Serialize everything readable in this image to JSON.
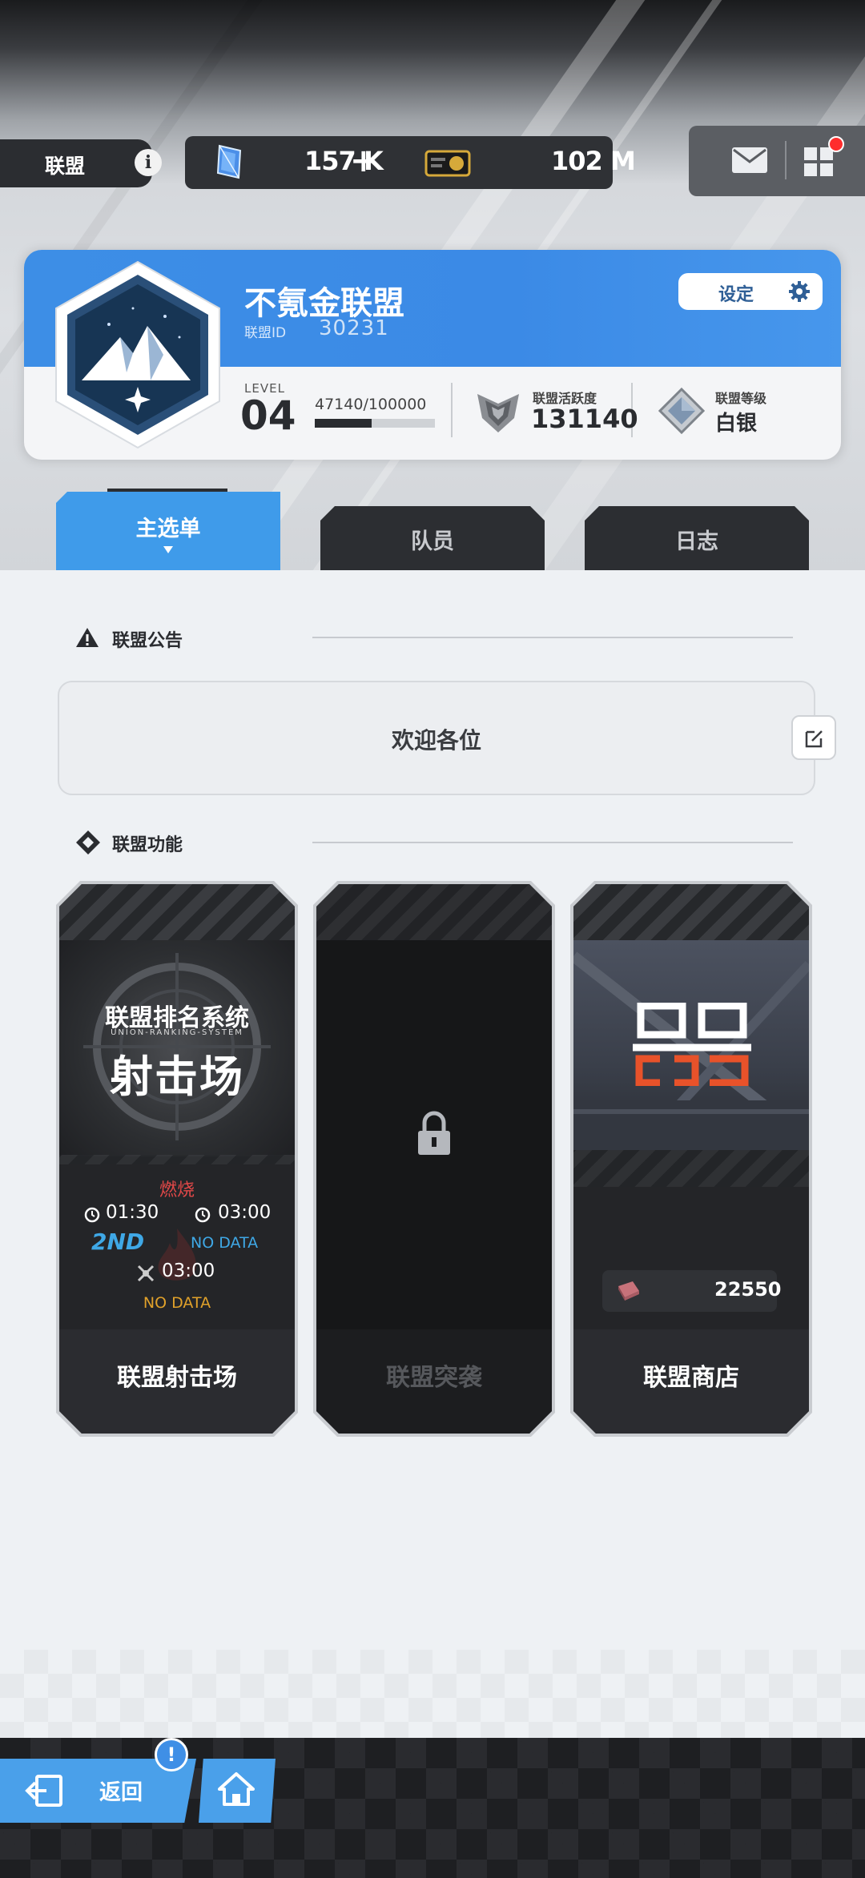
{
  "top_bar": {
    "section_title": "联盟",
    "info_icon": "i",
    "gems": "157 K",
    "gems_plus": "+",
    "tickets": "102 M"
  },
  "union": {
    "name": "不氪金联盟",
    "id_label": "联盟ID",
    "id": "30231",
    "settings_label": "设定",
    "level_label": "LEVEL",
    "level": "04",
    "xp_text": "47140/100000",
    "xp_progress": 0.4714,
    "activity_label": "联盟活跃度",
    "activity": "131140",
    "rank_label": "联盟等级",
    "rank": "白银"
  },
  "tabs": [
    {
      "label": "主选单"
    },
    {
      "label": "队员"
    },
    {
      "label": "日志"
    }
  ],
  "notice": {
    "title": "联盟公告",
    "text": "欢迎各位"
  },
  "functions": {
    "title": "联盟功能",
    "cards": [
      {
        "label": "联盟射击场",
        "banner_cn": "联盟排名系统",
        "banner_en": "UNION-RANKING-SYSTEM",
        "banner_big": "射击场",
        "status": "燃烧",
        "time1": "01:30",
        "time2": "03:00",
        "rank1": "2ND",
        "data2": "NO DATA",
        "time3": "03:00",
        "data3": "NO DATA"
      },
      {
        "label": "联盟突袭",
        "locked": true
      },
      {
        "label": "联盟商店",
        "currency": "22550"
      }
    ]
  },
  "bottom": {
    "back_label": "返回",
    "alert": "!"
  },
  "colors": {
    "accent_blue": "#3d8ee6",
    "status_red": "#e04848",
    "cyan": "#3fa8e6",
    "gold": "#e0a12a",
    "shop_orange": "#e8522a"
  }
}
